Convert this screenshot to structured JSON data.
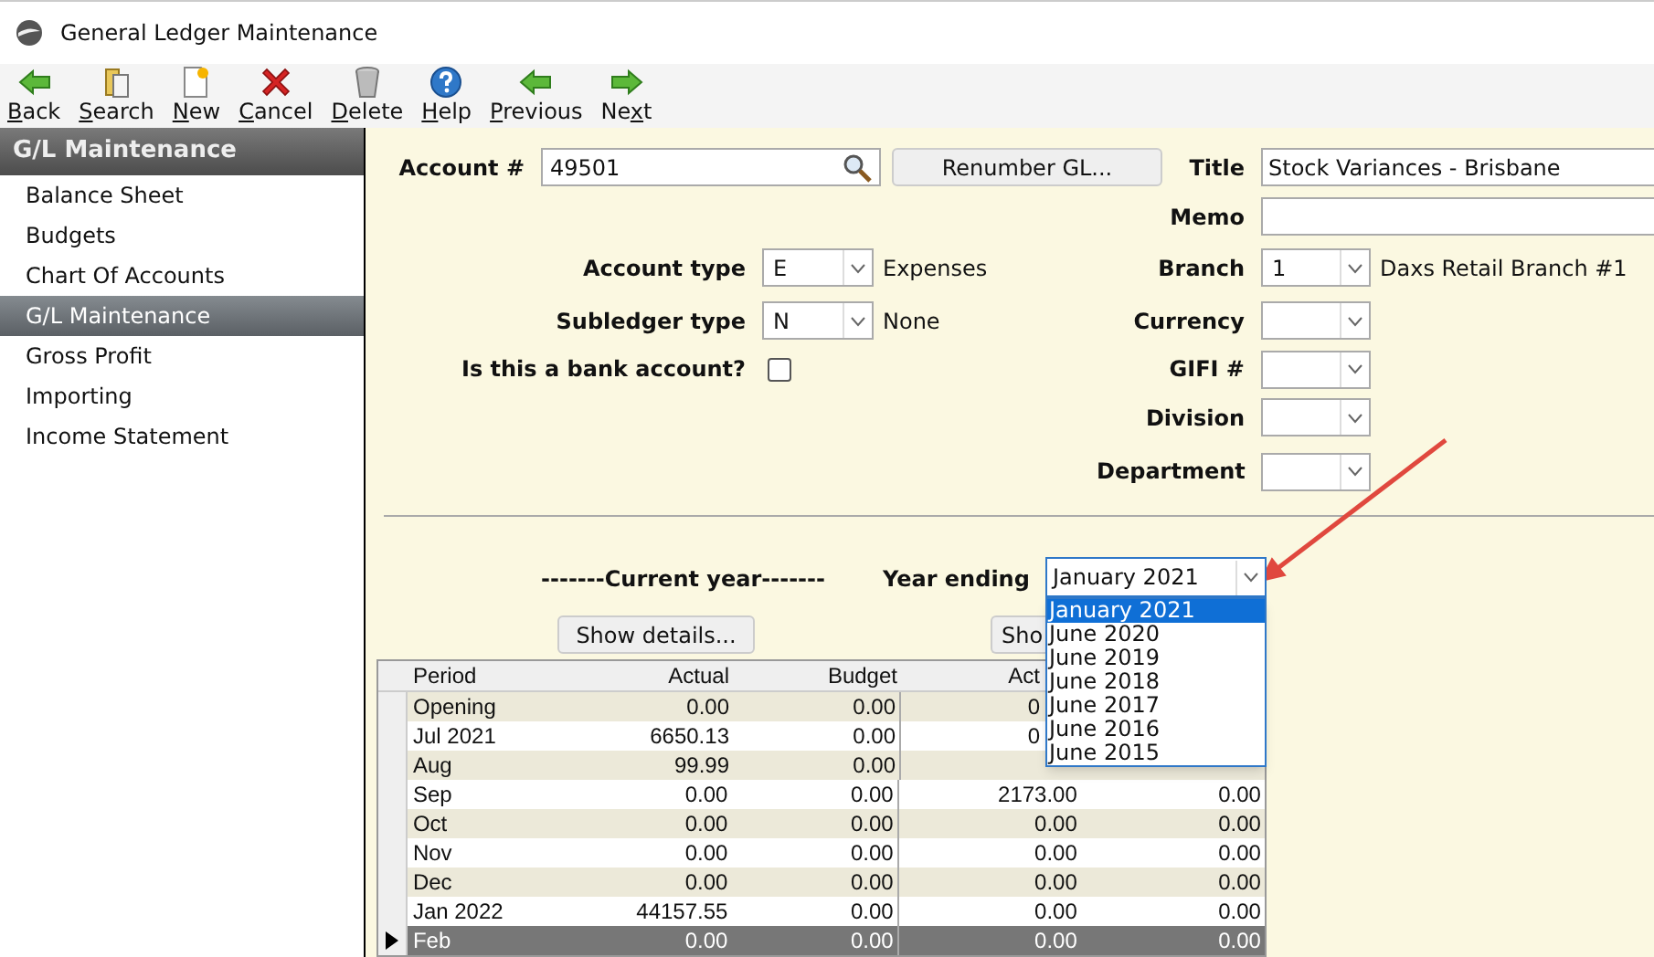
{
  "window": {
    "title": "General Ledger Maintenance"
  },
  "toolbar": [
    {
      "kind": "back",
      "key": "B",
      "post": "ack"
    },
    {
      "kind": "search",
      "key": "S",
      "post": "earch"
    },
    {
      "kind": "new",
      "key": "N",
      "post": "ew"
    },
    {
      "kind": "cancel",
      "key": "C",
      "post": "ancel"
    },
    {
      "kind": "delete",
      "key": "D",
      "post": "elete"
    },
    {
      "kind": "help",
      "key": "H",
      "post": "elp"
    },
    {
      "kind": "previous",
      "key": "P",
      "post": "revious"
    },
    {
      "kind": "next",
      "pre": "Ne",
      "key": "x",
      "post": "t"
    }
  ],
  "sidebar": {
    "title": "G/L Maintenance",
    "items": [
      {
        "label": "Balance Sheet",
        "selected": false
      },
      {
        "label": "Budgets",
        "selected": false
      },
      {
        "label": "Chart Of Accounts",
        "selected": false
      },
      {
        "label": "G/L Maintenance",
        "selected": true
      },
      {
        "label": "Gross Profit",
        "selected": false
      },
      {
        "label": "Importing",
        "selected": false
      },
      {
        "label": "Income Statement",
        "selected": false
      }
    ]
  },
  "form": {
    "account": {
      "label": "Account #",
      "value": "49501"
    },
    "renumber_button": "Renumber GL...",
    "account_type": {
      "label": "Account type",
      "value": "E",
      "description": "Expenses"
    },
    "subledger_type": {
      "label": "Subledger type",
      "value": "N",
      "description": "None"
    },
    "bank_account": {
      "label": "Is this a bank account?",
      "checked": false
    },
    "title": {
      "label": "Title",
      "value": "Stock Variances - Brisbane"
    },
    "memo": {
      "label": "Memo"
    },
    "branch": {
      "label": "Branch",
      "value": "1",
      "description": "Daxs Retail Branch #1"
    },
    "currency": {
      "label": "Currency"
    },
    "gifi": {
      "label": "GIFI #"
    },
    "division": {
      "label": "Division"
    },
    "department": {
      "label": "Department"
    }
  },
  "year": {
    "heading": "-------Current year-------",
    "label": "Year ending",
    "value": "January 2021",
    "expanded": true,
    "options": [
      {
        "label": "January 2021",
        "selected": true
      },
      {
        "label": "June 2020",
        "selected": false
      },
      {
        "label": "June 2019",
        "selected": false
      },
      {
        "label": "June 2018",
        "selected": false
      },
      {
        "label": "June 2017",
        "selected": false
      },
      {
        "label": "June 2016",
        "selected": false
      },
      {
        "label": "June 2015",
        "selected": false
      }
    ]
  },
  "buttons": [
    "Show details...",
    "Sho"
  ],
  "table": {
    "columns": [
      "Period",
      "Actual",
      "Budget",
      "Act"
    ],
    "rows": [
      {
        "cells": [
          "Opening",
          "0.00",
          "0.00",
          "0"
        ],
        "selected": false
      },
      {
        "cells": [
          "Jul 2021",
          "6650.13",
          "0.00",
          "0"
        ],
        "selected": false
      },
      {
        "cells": [
          "Aug",
          "99.99",
          "0.00"
        ],
        "selected": false
      },
      {
        "cells": [
          "Sep",
          "0.00",
          "0.00",
          "2173.00",
          "0.00"
        ],
        "selected": false
      },
      {
        "cells": [
          "Oct",
          "0.00",
          "0.00",
          "0.00",
          "0.00"
        ],
        "selected": false
      },
      {
        "cells": [
          "Nov",
          "0.00",
          "0.00",
          "0.00",
          "0.00"
        ],
        "selected": false
      },
      {
        "cells": [
          "Dec",
          "0.00",
          "0.00",
          "0.00",
          "0.00"
        ],
        "selected": false
      },
      {
        "cells": [
          "Jan 2022",
          "44157.55",
          "0.00",
          "0.00",
          "0.00"
        ],
        "selected": false
      },
      {
        "cells": [
          "Feb",
          "0.00",
          "0.00",
          "0.00",
          "0.00"
        ],
        "selected": true
      }
    ]
  }
}
